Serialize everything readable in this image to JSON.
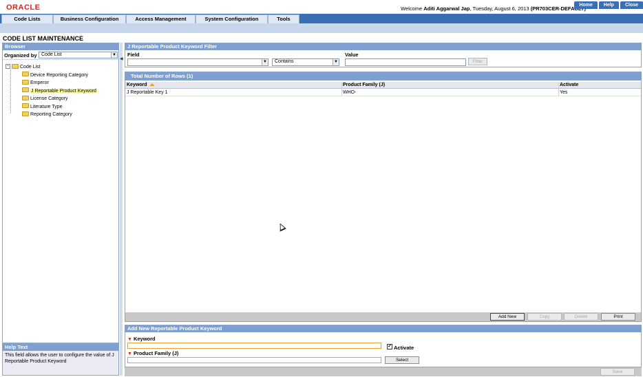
{
  "header": {
    "logo": "ORACLE",
    "welcome_prefix": "Welcome ",
    "user_name": "Aditi Aggarwal Jap",
    "date": ", Tuesday, August 6, 2013 ",
    "server": "(PR703CER-DEFAULT)",
    "buttons": [
      "Home",
      "Help",
      "Close"
    ]
  },
  "menu": [
    "Code Lists",
    "Business Configuration",
    "Access Management",
    "System Configuration",
    "Tools"
  ],
  "page_title": "CODE LIST MAINTENANCE",
  "browser": {
    "title": "Browser",
    "organized_by_label": "Organized by",
    "organized_by_value": "Code List",
    "tree": {
      "root": "Code List",
      "items": [
        "Device Reporting Category",
        "Emperor",
        "J Reportable Product Keyword",
        "License Category",
        "Literature Type",
        "Reporting Category"
      ],
      "selected_index": 2
    }
  },
  "help": {
    "title": "Help Text",
    "text": "This field allows the user to configure the value of J Reportable Product Keyword"
  },
  "filter": {
    "title": "J Reportable Product Keyword Filter",
    "field_label": "Field",
    "field_value": "",
    "operator_value": "Contains",
    "value_label": "Value",
    "value_value": "",
    "filter_button": "Filter"
  },
  "results": {
    "title": "Total Number of Rows (1)",
    "columns": [
      "Keyword",
      "Product Family (J)",
      "Activate"
    ],
    "rows": [
      [
        "J Reportable Key 1",
        "WHO-",
        "Yes"
      ]
    ],
    "buttons": {
      "add_new": "Add New",
      "copy": "Copy",
      "delete": "Delete",
      "print": "Print"
    }
  },
  "add_new": {
    "title": "Add New Reportable Product Keyword",
    "keyword_label": "Keyword",
    "keyword_value": "",
    "activate_label": "Activate",
    "activate_checked": true,
    "product_family_label": "Product Family (J)",
    "product_family_value": "",
    "select_button": "Select",
    "save_button": "Save"
  }
}
